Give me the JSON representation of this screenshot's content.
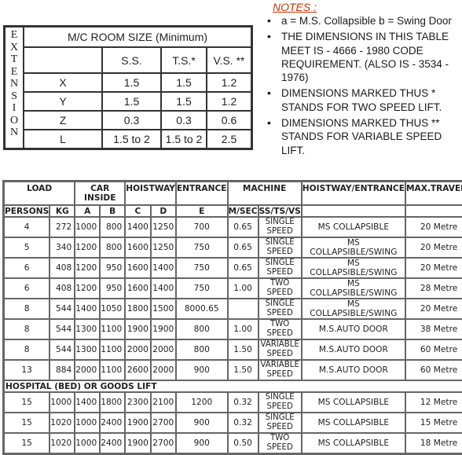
{
  "room_table": {
    "side_label_letters": [
      "E",
      "X",
      "T",
      "E",
      "N",
      "S",
      "I",
      "O",
      "N"
    ],
    "title": "M/C ROOM SIZE (Minimum)",
    "headers": [
      "",
      "S.S.",
      "T.S.*",
      "V.S. **"
    ],
    "rows": [
      [
        "X",
        "1.5",
        "1.5",
        "1.2"
      ],
      [
        "Y",
        "1.5",
        "1.5",
        "1.2"
      ],
      [
        "Z",
        "0.3",
        "0.3",
        "0.6"
      ],
      [
        "L",
        "1.5 to 2",
        "1.5 to 2",
        "2.5"
      ]
    ]
  },
  "notes": {
    "title": "NOTES :",
    "items": [
      "a = M.S. Collapsible b = Swing Door",
      "THE DIMENSIONS IN THIS TABLE MEET IS - 4666 - 1980 CODE REQUIREMENT. (ALSO IS - 3534 - 1976)",
      "DIMENSIONS MARKED THUS * STANDS FOR TWO SPEED LIFT.",
      "DIMENSIONS MARKED THUS ** STANDS FOR VARIABLE SPEED LIFT."
    ]
  },
  "lift_table": {
    "group_headers": [
      "LOAD",
      "CAR INSIDE",
      "HOISTWAY",
      "ENTRANCE",
      "MACHINE",
      "HOISTWAY/ENTRANCE",
      "MAX.TRAVELE"
    ],
    "sub_headers": [
      "PERSONS",
      "KG",
      "A",
      "B",
      "C",
      "D",
      "E",
      "M/SEC",
      "SS/TS/VS",
      "",
      ""
    ],
    "rows": [
      {
        "persons": "4",
        "kg": "272",
        "a": "1000",
        "b": "800",
        "c": "1400",
        "d": "1250",
        "e": "700",
        "msec": "0.65",
        "speed1": "SINGLE",
        "speed2": "SPEED",
        "door": "MS COLLAPSIBLE",
        "travel": "20 Metre"
      },
      {
        "persons": "5",
        "kg": "340",
        "a": "1200",
        "b": "800",
        "c": "1600",
        "d": "1250",
        "e": "750",
        "msec": "0.65",
        "speed1": "SINGLE",
        "speed2": "SPEED",
        "door": "MS COLLAPSIBLE/SWING",
        "travel": "20 Metre"
      },
      {
        "persons": "6",
        "kg": "408",
        "a": "1200",
        "b": "950",
        "c": "1600",
        "d": "1400",
        "e": "750",
        "msec": "0.65",
        "speed1": "SINGLE",
        "speed2": "SPEED",
        "door": "MS COLLAPSIBLE/SWING",
        "travel": "20 Metre"
      },
      {
        "persons": "6",
        "kg": "408",
        "a": "1200",
        "b": "950",
        "c": "1600",
        "d": "1400",
        "e": "750",
        "msec": "1.00",
        "speed1": "TWO",
        "speed2": "SPEED",
        "door": "MS COLLAPSIBLE/SWING",
        "travel": "28 Metre"
      },
      {
        "persons": "8",
        "kg": "544",
        "a": "1400",
        "b": "1050",
        "c": "1800",
        "d": "1500",
        "e": "8000.65",
        "msec": "",
        "speed1": "SINGLE",
        "speed2": "SPEED",
        "door": "MS COLLAPSIBLE/SWING",
        "travel": "20 Metre"
      },
      {
        "persons": "8",
        "kg": "544",
        "a": "1300",
        "b": "1100",
        "c": "1900",
        "d": "1900",
        "e": "800",
        "msec": "1.00",
        "speed1": "TWO",
        "speed2": "SPEED",
        "door": "M.S.AUTO DOOR",
        "travel": "38 Metre"
      },
      {
        "persons": "8",
        "kg": "544",
        "a": "1300",
        "b": "1100",
        "c": "2000",
        "d": "2000",
        "e": "800",
        "msec": "1.50",
        "speed1": "VARIABLE",
        "speed2": "SPEED",
        "door": "M.S.AUTO DOOR",
        "travel": "60 Metre"
      },
      {
        "persons": "13",
        "kg": "884",
        "a": "2000",
        "b": "1100",
        "c": "2600",
        "d": "2000",
        "e": "900",
        "msec": "1.50",
        "speed1": "VARIABLE",
        "speed2": "SPEED",
        "door": "M.S.AUTO DOOR",
        "travel": "60 Metre"
      }
    ],
    "section_label": "HOSPITAL (BED) OR GOODS LIFT",
    "section_rows": [
      {
        "persons": "15",
        "kg": "1000",
        "a": "1400",
        "b": "1800",
        "c": "2300",
        "d": "2100",
        "e": "1200",
        "msec": "0.32",
        "speed1": "SINGLE",
        "speed2": "SPEED",
        "door": "MS COLLAPSIBLE",
        "travel": "12 Metre"
      },
      {
        "persons": "15",
        "kg": "1020",
        "a": "1000",
        "b": "2400",
        "c": "1900",
        "d": "2700",
        "e": "900",
        "msec": "0.32",
        "speed1": "SINGLE",
        "speed2": "SPEED",
        "door": "MS COLLAPSIBLE",
        "travel": "15 Metre"
      },
      {
        "persons": "15",
        "kg": "1020",
        "a": "1000",
        "b": "2400",
        "c": "1900",
        "d": "2700",
        "e": "900",
        "msec": "0.50",
        "speed1": "TWO",
        "speed2": "SPEED",
        "door": "MS COLLAPSIBLE",
        "travel": "18 Metre"
      }
    ]
  }
}
